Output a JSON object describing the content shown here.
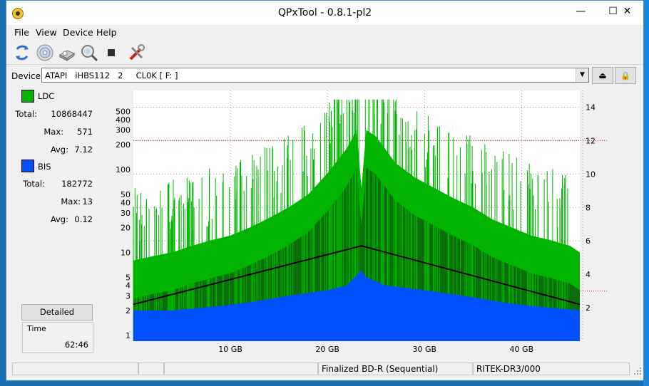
{
  "window": {
    "title": "QPxTool - 0.8.1-pl2"
  },
  "titlebar": {
    "minimize_glyph": "—",
    "maximize_glyph": "☐",
    "close_glyph": "✕"
  },
  "menu": [
    "File",
    "View",
    "Device",
    "Help"
  ],
  "toolbar": {
    "icons": [
      "refresh-icon",
      "disc-info-icon",
      "scan-device-icon",
      "search-scan-icon",
      "stop-icon",
      "tools-icon"
    ]
  },
  "device": {
    "label": "Device:",
    "value": "ATAPI   iHBS112   2     CL0K [ F: ]",
    "eject_glyph": "⏏",
    "lock_glyph": "🔒"
  },
  "legend": {
    "ldc": {
      "name": "LDC",
      "color": "#00b400",
      "total_label": "Total:",
      "total": "10868447",
      "max_label": "Max:",
      "max": "571",
      "avg_label": "Avg:",
      "avg": "7.12"
    },
    "bis": {
      "name": "BIS",
      "color": "#0050ff",
      "total_label": "Total:",
      "total": "182772",
      "max_label": "Max:",
      "max": "13",
      "avg_label": "Avg:",
      "avg": "0.12"
    }
  },
  "detailed_button": "Detailed",
  "time": {
    "label": "Time",
    "value": "62:46"
  },
  "status": {
    "disc_type": "Finalized BD-R (Sequential)",
    "media_id": "RITEK-DR3/000"
  },
  "chart_data": {
    "type": "area",
    "x_unit": "GB",
    "x_range": [
      0,
      46
    ],
    "x_ticks": [
      "10 GB",
      "20 GB",
      "30 GB",
      "40 GB"
    ],
    "x_tick_values": [
      10,
      20,
      30,
      40
    ],
    "y_left_scale": "log",
    "y_left_ticks": [
      1,
      2,
      3,
      4,
      5,
      10,
      20,
      30,
      40,
      50,
      100,
      200,
      300,
      400,
      500
    ],
    "y_left_range": [
      0.85,
      900
    ],
    "y_right_ticks": [
      2,
      4,
      6,
      8,
      10,
      12,
      14
    ],
    "y_right_range": [
      0,
      15
    ],
    "red_dotted_lines_right": [
      3,
      12
    ],
    "grid": true,
    "series": [
      {
        "name": "LDC",
        "color": "#00b400",
        "x": [
          0,
          2,
          4,
          6,
          8,
          10,
          12,
          14,
          16,
          18,
          20,
          22,
          23,
          23.5,
          24,
          25,
          27,
          29,
          31,
          33,
          35,
          37,
          39,
          41,
          43,
          45,
          46
        ],
        "y": [
          8,
          9,
          10,
          12,
          14,
          16,
          20,
          26,
          35,
          50,
          90,
          180,
          300,
          60,
          300,
          250,
          120,
          80,
          60,
          45,
          35,
          25,
          20,
          16,
          14,
          12,
          10
        ]
      },
      {
        "name": "BIS",
        "color": "#0050ff",
        "x": [
          0,
          4,
          8,
          12,
          16,
          20,
          22,
          23.5,
          24,
          26,
          30,
          34,
          38,
          42,
          46
        ],
        "y": [
          2,
          2,
          2.2,
          2.5,
          3,
          3.5,
          4,
          6,
          5,
          4,
          3.5,
          3,
          2.5,
          2.2,
          2
        ]
      },
      {
        "name": "Speed",
        "x": [
          0,
          23.5,
          46
        ],
        "y": [
          2.2,
          5.7,
          2.2
        ]
      }
    ]
  }
}
